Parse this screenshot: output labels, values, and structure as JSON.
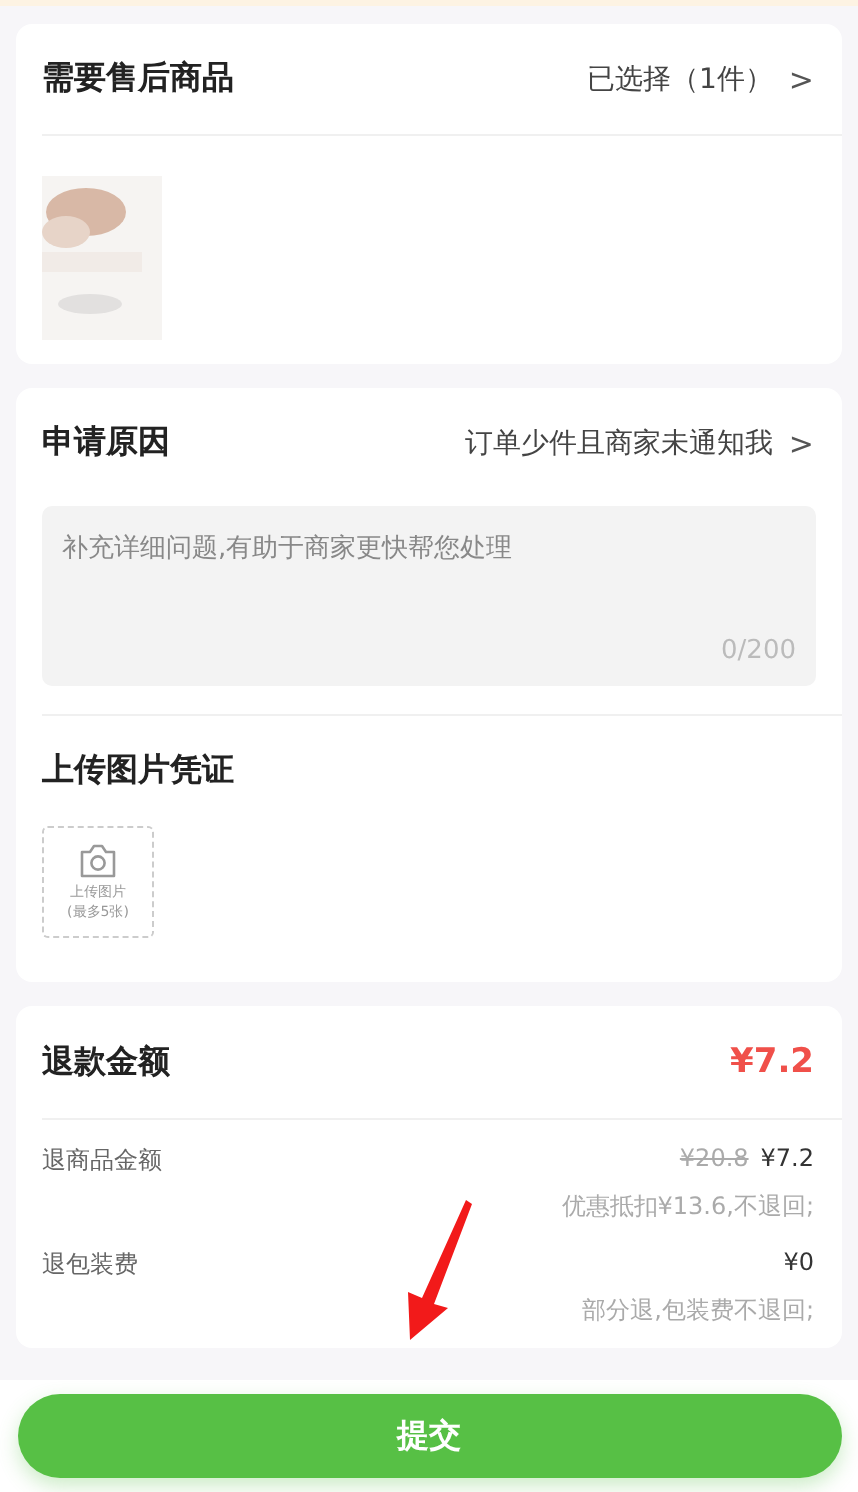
{
  "goods": {
    "title": "需要售后商品",
    "selection": "已选择（1件）",
    "chevron": ">"
  },
  "reason": {
    "title": "申请原因",
    "value": "订单少件且商家未通知我",
    "chevron": ">",
    "detail": {
      "placeholder": "补充详细问题,有助于商家更快帮您处理",
      "counter": "0/200"
    }
  },
  "upload": {
    "title": "上传图片凭证",
    "button_lines": [
      "上传图片",
      "(最多5张)"
    ]
  },
  "refund": {
    "title": "退款金额",
    "total": "¥7.2",
    "rows": [
      {
        "label": "退商品金额",
        "original": "¥20.8",
        "amount": "¥7.2",
        "note": "优惠抵扣¥13.6,不退回;"
      },
      {
        "label": "退包装费",
        "amount": "¥0",
        "note": "部分退,包装费不退回;"
      }
    ]
  },
  "submit": "提交"
}
